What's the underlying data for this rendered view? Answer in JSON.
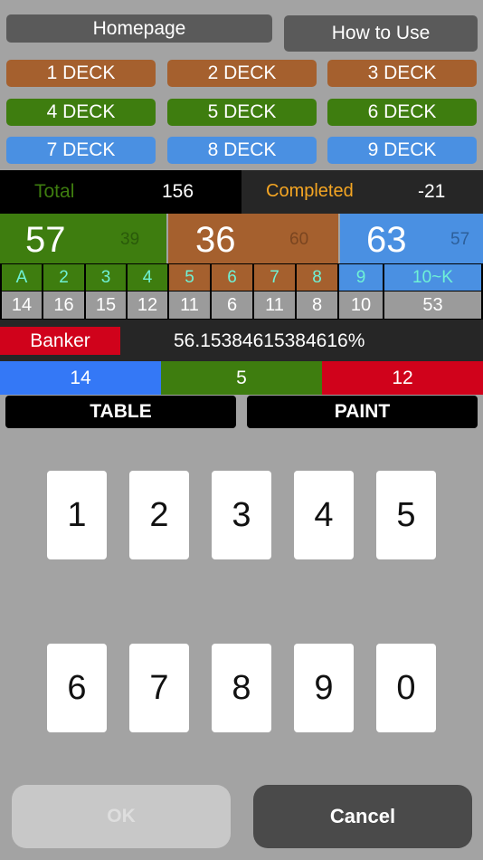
{
  "top_buttons": {
    "homepage": "Homepage",
    "how_to_use": "How to Use"
  },
  "decks": [
    "1 DECK",
    "2 DECK",
    "3 DECK",
    "4 DECK",
    "5 DECK",
    "6 DECK",
    "7 DECK",
    "8 DECK",
    "9 DECK"
  ],
  "summary": {
    "total_label": "Total",
    "total_value": "156",
    "completed_label": "Completed",
    "completed_value": "-21"
  },
  "groups": [
    {
      "main": "57",
      "sub": "39"
    },
    {
      "main": "36",
      "sub": "60"
    },
    {
      "main": "63",
      "sub": "57"
    }
  ],
  "ranks": [
    "A",
    "2",
    "3",
    "4",
    "5",
    "6",
    "7",
    "8",
    "9",
    "10~K"
  ],
  "counts": [
    "14",
    "16",
    "15",
    "12",
    "11",
    "6",
    "11",
    "8",
    "10",
    "53"
  ],
  "banker": {
    "label": "Banker",
    "value": "56.15384615384616%"
  },
  "results": [
    "14",
    "5",
    "12"
  ],
  "tabs": {
    "table": "TABLE",
    "paint": "PAINT"
  },
  "keypad": [
    "1",
    "2",
    "3",
    "4",
    "5",
    "6",
    "7",
    "8",
    "9",
    "0"
  ],
  "actions": {
    "ok": "OK",
    "cancel": "Cancel"
  },
  "colors": {
    "brown": "#a5602e",
    "green": "#3e7d0f",
    "blue": "#4a90e2",
    "red": "#d0021b",
    "cyan": "#6ff2d6"
  }
}
